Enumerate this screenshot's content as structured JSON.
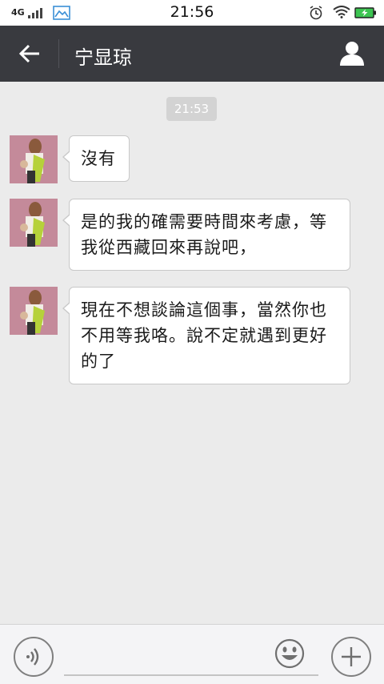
{
  "status_bar": {
    "network": "4G",
    "time": "21:56",
    "icons": [
      "signal-icon",
      "gallery-icon",
      "alarm-icon",
      "wifi-icon",
      "battery-charging-icon"
    ]
  },
  "header": {
    "title": "宁显琼",
    "icons": [
      "back-arrow-icon",
      "profile-icon"
    ]
  },
  "chat": {
    "timestamp": "21:53",
    "messages": [
      {
        "sender": "contact",
        "text": "沒有"
      },
      {
        "sender": "contact",
        "text": "是的我的確需要時間來考慮，等我從西藏回來再說吧，"
      },
      {
        "sender": "contact",
        "text": "現在不想談論這個事，當然你也不用等我咯。說不定就遇到更好的了"
      }
    ]
  },
  "input_bar": {
    "value": "",
    "icons": [
      "voice-icon",
      "emoji-icon",
      "plus-icon"
    ]
  },
  "colors": {
    "header_bg": "#393a3f",
    "chat_bg": "#ebebeb",
    "bubble_bg": "#ffffff",
    "timestamp_bg": "#d3d3d3"
  }
}
